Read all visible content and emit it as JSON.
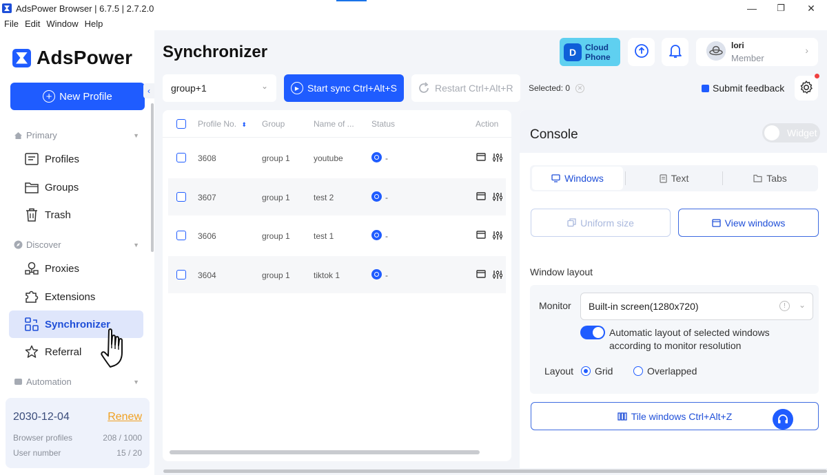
{
  "window": {
    "title": "AdsPower Browser | 6.7.5 | 2.7.2.0",
    "minimize": "—",
    "maximize": "❐",
    "close": "✕"
  },
  "menu": [
    "File",
    "Edit",
    "Window",
    "Help"
  ],
  "sidebar": {
    "logo": "AdsPower",
    "new_profile": "New Profile",
    "sections": {
      "primary": "Primary",
      "discover": "Discover",
      "automation": "Automation"
    },
    "items": [
      {
        "label": "Profiles",
        "icon": "profiles-icon"
      },
      {
        "label": "Groups",
        "icon": "folder-icon"
      },
      {
        "label": "Trash",
        "icon": "trash-icon"
      },
      {
        "label": "Proxies",
        "icon": "proxies-icon"
      },
      {
        "label": "Extensions",
        "icon": "puzzle-icon"
      },
      {
        "label": "Synchronizer",
        "icon": "synchronizer-icon",
        "active": true
      },
      {
        "label": "Referral",
        "icon": "star-icon"
      }
    ],
    "subscription": {
      "date": "2030-12-04",
      "renew": "Renew",
      "browser_profiles_label": "Browser profiles",
      "browser_profiles_value": "208 / 1000",
      "user_number_label": "User number",
      "user_number_value": "15 / 20"
    }
  },
  "header": {
    "title": "Synchronizer",
    "cloud_phone_line1": "Cloud",
    "cloud_phone_line2": "Phone",
    "user_name": "lori",
    "user_role": "Member"
  },
  "toolbar": {
    "group_value": "group+1",
    "start_sync": "Start sync Ctrl+Alt+S",
    "restart": "Restart Ctrl+Alt+R",
    "selected": "Selected: 0",
    "feedback": "Submit feedback"
  },
  "table": {
    "columns": [
      "Profile No.",
      "Group",
      "Name of ...",
      "Status",
      "Action"
    ],
    "rows": [
      {
        "no": "3608",
        "group": "group 1",
        "name": "youtube",
        "status": "-"
      },
      {
        "no": "3607",
        "group": "group 1",
        "name": "test 2",
        "status": "-"
      },
      {
        "no": "3606",
        "group": "group 1",
        "name": "test 1",
        "status": "-"
      },
      {
        "no": "3604",
        "group": "group 1",
        "name": "tiktok 1",
        "status": "-"
      }
    ]
  },
  "console": {
    "title": "Console",
    "widget": "Widget",
    "tabs": [
      "Windows",
      "Text",
      "Tabs"
    ],
    "uniform_size": "Uniform size",
    "view_windows": "View windows",
    "window_layout": "Window layout",
    "monitor_label": "Monitor",
    "monitor_value": "Built-in screen(1280x720)",
    "auto_layout": "Automatic layout of selected windows according to monitor resolution",
    "layout_label": "Layout",
    "layout_options": [
      "Grid",
      "Overlapped"
    ],
    "layout_selected": "Grid",
    "tile_windows": "Tile windows Ctrl+Alt+Z"
  },
  "colors": {
    "accent": "#1f5cff",
    "active_nav_bg": "#dfe6fb",
    "renew": "#f0a020",
    "cloud_phone": "#5fd0f0"
  }
}
